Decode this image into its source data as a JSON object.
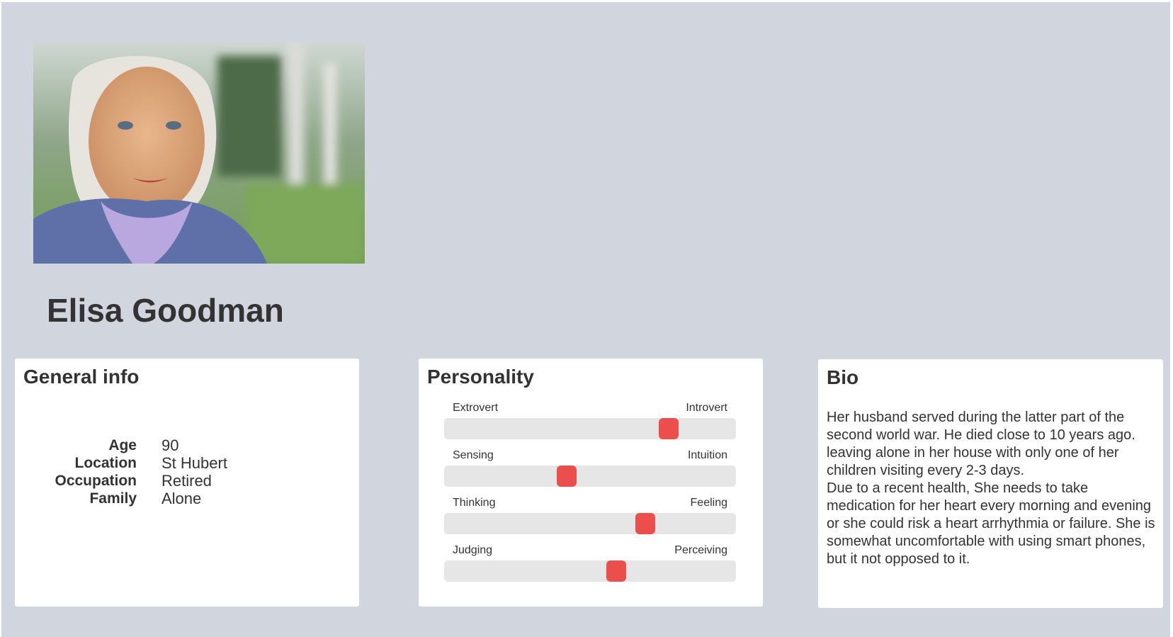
{
  "persona": {
    "name": "Elisa Goodman"
  },
  "general_info": {
    "title": "General info",
    "rows": [
      {
        "label": "Age",
        "value": "90"
      },
      {
        "label": "Location",
        "value": "St Hubert"
      },
      {
        "label": "Occupation",
        "value": "Retired"
      },
      {
        "label": "Family",
        "value": "Alone"
      }
    ]
  },
  "personality": {
    "title": "Personality",
    "traits": [
      {
        "left": "Extrovert",
        "right": "Introvert",
        "level": 0.77
      },
      {
        "left": "Sensing",
        "right": "Intuition",
        "level": 0.42
      },
      {
        "left": "Thinking",
        "right": "Feeling",
        "level": 0.69
      },
      {
        "left": "Judging",
        "right": "Perceiving",
        "level": 0.59
      }
    ]
  },
  "bio": {
    "title": "Bio",
    "text": "Her husband served during the latter part of the second world war. He died close to 10 years ago. leaving alone in her house with only one of her children visiting every 2-3 days.\nDue to a recent health, She needs to take medication for her heart every morning and evening or she could risk a heart arrhythmia or failure. She is somewhat uncomfortable with using smart phones, but it not opposed to it."
  },
  "colors": {
    "background": "#d1d6de",
    "card": "#ffffff",
    "slider_track": "#e6e6e6",
    "slider_thumb": "#ec4e4b",
    "text": "#333333"
  }
}
